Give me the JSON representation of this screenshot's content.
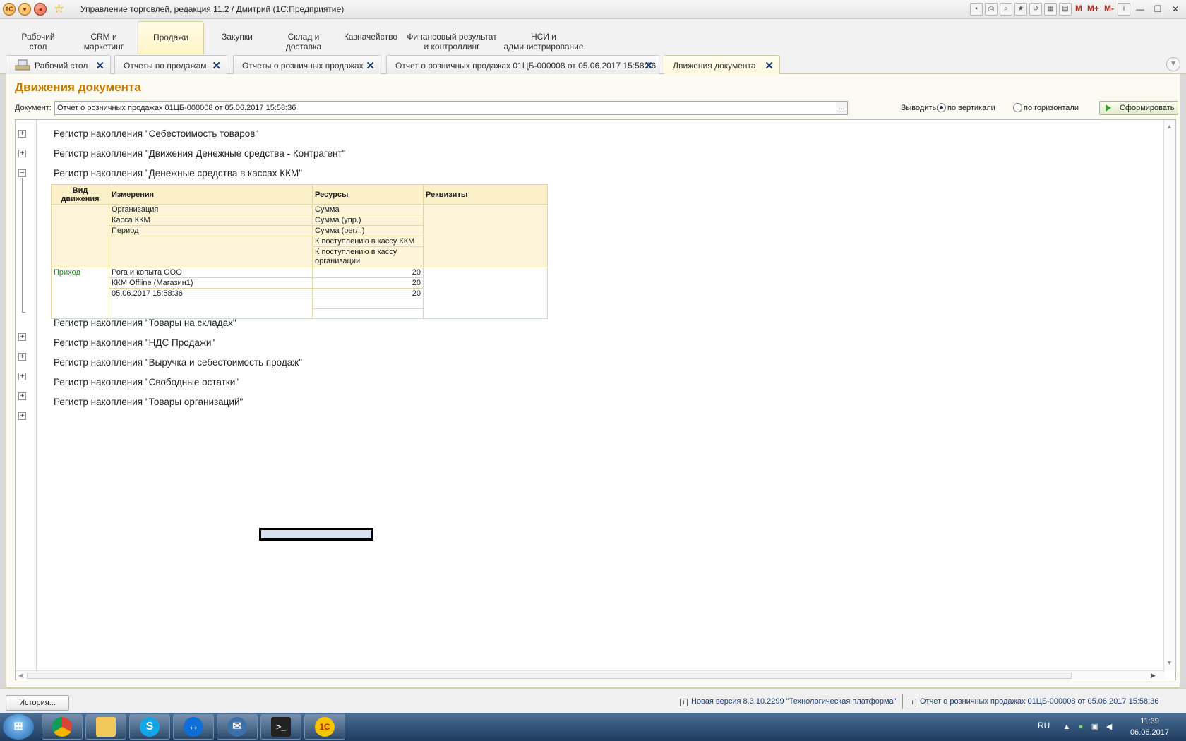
{
  "window": {
    "title": "Управление торговлей, редакция 11.2 / Дмитрий  (1С:Предприятие)",
    "logo_text": "1С",
    "toolbar_m": "M",
    "toolbar_mplus": "M+",
    "toolbar_mminus": "M-"
  },
  "sections": [
    {
      "label": "Рабочий\nстол"
    },
    {
      "label": "CRM и\nмаркетинг"
    },
    {
      "label": "Продажи"
    },
    {
      "label": "Закупки"
    },
    {
      "label": "Склад и\nдоставка"
    },
    {
      "label": "Казначейство"
    },
    {
      "label": "Финансовый результат\nи контроллинг"
    },
    {
      "label": "НСИ и\nадминистрирование"
    }
  ],
  "tabs": [
    {
      "label": "Рабочий стол"
    },
    {
      "label": "Отчеты по продажам"
    },
    {
      "label": "Отчеты о розничных продажах"
    },
    {
      "label": "Отчет о розничных продажах 01ЦБ-000008 от 05.06.2017 15:58:36"
    },
    {
      "label": "Движения документа"
    }
  ],
  "form": {
    "title": "Движения документа",
    "document_label": "Документ:",
    "document_value": "Отчет о розничных продажах 01ЦБ-000008 от 05.06.2017 15:58:36",
    "select_button": "...",
    "output_label": "Выводить:",
    "radio_vertical": "по вертикали",
    "radio_horizontal": "по горизонтали",
    "generate_button": "Сформировать"
  },
  "registers_top": [
    {
      "name": "Регистр накопления \"Себестоимость товаров\"",
      "expanded": false
    },
    {
      "name": "Регистр накопления \"Движения Денежные средства - Контрагент\"",
      "expanded": false
    },
    {
      "name": "Регистр накопления \"Денежные средства в кассах ККМ\"",
      "expanded": true
    }
  ],
  "movements_table": {
    "headers": {
      "kind": "Вид движения",
      "dimensions": "Измерения",
      "resources": "Ресурсы",
      "attributes": "Реквизиты"
    },
    "dimension_names": [
      "Организация",
      "Касса ККМ",
      "Период"
    ],
    "resource_names": [
      "Сумма",
      "Сумма (упр.)",
      "Сумма (регл.)",
      "К поступлению в кассу ККМ",
      "К поступлению в кассу организации"
    ],
    "row": {
      "kind": "Приход",
      "dimensions": [
        "Рога и копыта ООО",
        "ККМ Offline (Магазин1)",
        "05.06.2017 15:58:36"
      ],
      "resources": [
        "20",
        "20",
        "20",
        "",
        ""
      ]
    }
  },
  "registers_bottom": [
    {
      "name": "Регистр накопления \"Товары на складах\""
    },
    {
      "name": "Регистр накопления \"НДС Продажи\""
    },
    {
      "name": "Регистр накопления \"Выручка и себестоимость продаж\""
    },
    {
      "name": "Регистр накопления \"Свободные остатки\""
    },
    {
      "name": "Регистр накопления \"Товары организаций\""
    }
  ],
  "statusbar": {
    "history_button": "История...",
    "msg_version": "Новая версия 8.3.10.2299 \"Технологическая платформа\"",
    "msg_document": "Отчет о розничных продажах 01ЦБ-000008 от 05.06.2017 15:58:36"
  },
  "taskbar": {
    "lang": "RU",
    "time": "11:39",
    "date": "06.06.2017",
    "apps": [
      "chrome",
      "explorer",
      "skype",
      "teamviewer",
      "thunderbird",
      "terminal",
      "1c"
    ]
  },
  "colors": {
    "title_accent": "#c07800",
    "table_header_bg": "#fbf0c8",
    "movement_kind": "#2e8b2e",
    "status_link": "#1d3e6d"
  }
}
